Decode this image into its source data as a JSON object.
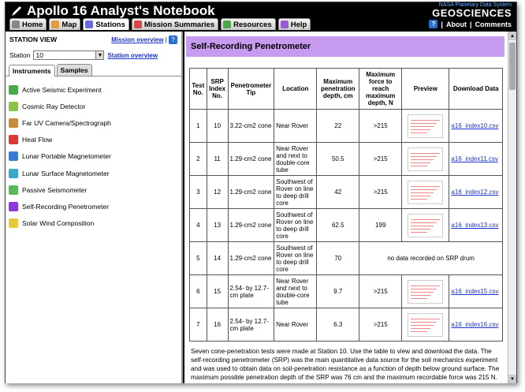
{
  "app": {
    "title": "Apollo 16 Analyst's Notebook",
    "tabs": [
      {
        "label": "Home",
        "color": "#888888"
      },
      {
        "label": "Map",
        "color": "#e89b3c"
      },
      {
        "label": "Stations",
        "color": "#6a6ad8"
      },
      {
        "label": "Mission Summaries",
        "color": "#d84a4a"
      },
      {
        "label": "Resources",
        "color": "#4aa84a"
      },
      {
        "label": "Help",
        "color": "#9a5ad8"
      }
    ],
    "active_tab": "Stations"
  },
  "brand": {
    "nasa": "NASA",
    "pds": "Planetary Data System",
    "name": "GEOSCIENCES",
    "links": [
      "About",
      "Comments"
    ]
  },
  "sidebar": {
    "heading": "STATION VIEW",
    "mission_overview": "Mission overview",
    "station_label": "Station",
    "station_value": "10",
    "station_overview": "Station overview",
    "subtabs": [
      "Instruments",
      "Samples"
    ],
    "instruments": [
      {
        "label": "Active Seismic Experiment",
        "color": "#4aa84a"
      },
      {
        "label": "Cosmic Ray Detector",
        "color": "#8bc34a"
      },
      {
        "label": "Far UV Camera/Spectrograph",
        "color": "#c98a3a"
      },
      {
        "label": "Heat Flow",
        "color": "#d83a3a"
      },
      {
        "label": "Lunar Portable Magnetometer",
        "color": "#3a7ad8"
      },
      {
        "label": "Lunar Surface Magnetometer",
        "color": "#3aa8c8"
      },
      {
        "label": "Passive Seismometer",
        "color": "#5ab85a"
      },
      {
        "label": "Self-Recording Penetrometer",
        "color": "#8a3ad8"
      },
      {
        "label": "Solar Wind Composition",
        "color": "#e8c83a"
      }
    ]
  },
  "main": {
    "title": "Self-Recording Penetrometer",
    "headers": [
      "Test No.",
      "SRP Index No.",
      "Penetrometer Tip",
      "Location",
      "Maximum penetration depth, cm",
      "Maximum force to reach maximum depth, N",
      "Preview",
      "Download Data"
    ],
    "rows": [
      {
        "test": "1",
        "srp": "10",
        "tip": "3.22-cm2 cone",
        "loc": "Near Rover",
        "depth": "22",
        "force": ">215",
        "file": "a16_index10.csv"
      },
      {
        "test": "2",
        "srp": "11",
        "tip": "1.29-cm2 cone",
        "loc": "Near Rover and next to double-core tube",
        "depth": "50.5",
        "force": ">215",
        "file": "a16_index11.csv"
      },
      {
        "test": "3",
        "srp": "12",
        "tip": "1.29-cm2 cone",
        "loc": "Southwest of Rover on line to deep drill core",
        "depth": "42",
        "force": ">215",
        "file": "a16_index12.csv"
      },
      {
        "test": "4",
        "srp": "13",
        "tip": "1.29-cm2 cone",
        "loc": "Southwest of Rover on line to deep drill core",
        "depth": "62.5",
        "force": "199",
        "file": "a16_index13.csv"
      },
      {
        "test": "5",
        "srp": "14",
        "tip": "1.29-cm2 cone",
        "loc": "Southwest of Rover on line to deep drill core",
        "depth": "70",
        "force": "no data recorded on SRP drum",
        "file": ""
      },
      {
        "test": "6",
        "srp": "15",
        "tip": "2.54- by 12.7-cm plate",
        "loc": "Near Rover and next to double-core tube",
        "depth": "9.7",
        "force": ">215",
        "file": "a16_index15.csv"
      },
      {
        "test": "7",
        "srp": "16",
        "tip": "2.54- by 12.7-cm plate",
        "loc": "Near Rover",
        "depth": "6.3",
        "force": ">215",
        "file": "a16_index16.csv"
      }
    ],
    "description": "Seven cone-penetration tests were made at Station 10. Use the table to view and download the data. The self-recording penetrometer (SRP) was the main quantitative data source for the soil mechanics experiment and was used to obtain data on soil-penetration resistance as a function of depth below ground surface. The maximum possible penetration depth of the SRP was 76 cm and the maximum recordable force was 215 N."
  }
}
